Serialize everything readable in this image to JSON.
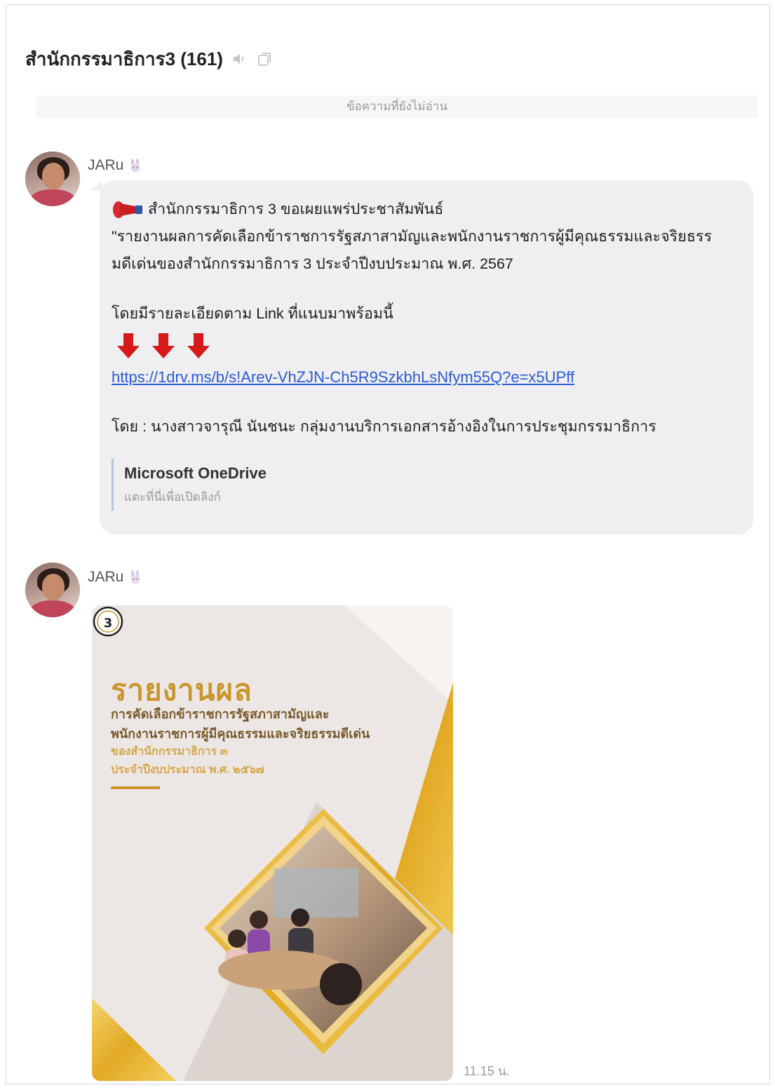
{
  "chat": {
    "title": "สำนักกรรมาธิการ3 (161)",
    "unread_label": "ข้อความที่ยังไม่อ่าน"
  },
  "messages": [
    {
      "sender": "JARu",
      "lines": [
        "สำนักกรรมาธิการ 3 ขอเผยแพร่ประชาสัมพันธ์",
        "\"รายงานผลการคัดเลือกข้าราชการรัฐสภาสามัญและพนักงานราชการผู้มีคุณธรรมและจริยธรร",
        "มดีเด่นของสำนักกรรมาธิการ 3 ประจำปีงบประมาณ พ.ศ. 2567",
        "โดยมีรายละเอียดตาม Link ที่แนบมาพร้อมนี้"
      ],
      "link": "https://1drv.ms/b/s!Arev-VhZJN-Ch5R9SzkbhLsNfym55Q?e=x5UPff",
      "byline": "โดย : นางสาวจารุณี นันชนะ กลุ่มงานบริการเอกสารอ้างอิงในการประชุมกรรมาธิการ",
      "preview": {
        "title": "Microsoft OneDrive",
        "subtitle": "แตะที่นี่เพื่อเปิดลิงก์"
      }
    },
    {
      "sender": "JARu",
      "poster": {
        "logo_number": "3",
        "heading": "รายงานผล",
        "line1": "การคัดเลือกข้าราชการรัฐสภาสามัญและ",
        "line2": "พนักงานราชการผู้มีคุณธรรมและจริยธรรมดีเด่น",
        "line3": "ของสำนักกรรมาธิการ ๓",
        "line4": "ประจำปีงบประมาณ พ.ศ. ๒๕๖๗"
      },
      "time": "11.15 น."
    }
  ],
  "icons": {
    "speaker": "speaker-muted-icon",
    "copy": "copy-icon",
    "sender_badge": "bunny-icon",
    "megaphone": "megaphone-icon",
    "arrows": "arrow-down-icon"
  },
  "colors": {
    "bubble": "#efeff1",
    "link": "#2a5bd7",
    "arrow": "#d61a1a",
    "poster_gold": "#c9962b"
  }
}
